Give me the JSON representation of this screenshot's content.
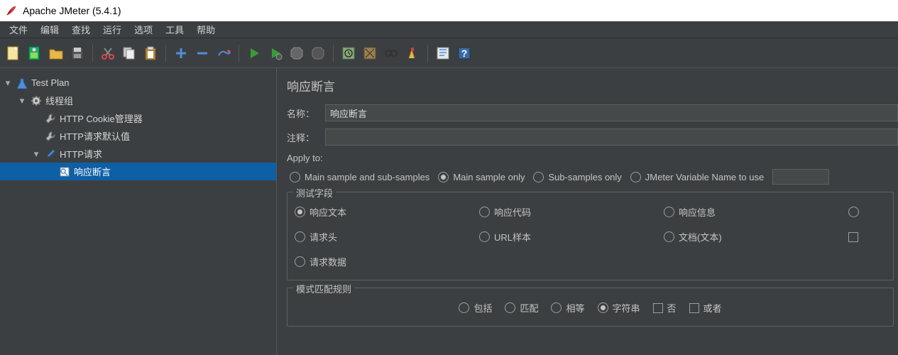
{
  "title": "Apache JMeter (5.4.1)",
  "menu": {
    "file": "文件",
    "edit": "编辑",
    "search": "查找",
    "run": "运行",
    "options": "选项",
    "tools": "工具",
    "help": "帮助"
  },
  "tree": {
    "root": "Test Plan",
    "threadgroup": "线程组",
    "cookie": "HTTP Cookie管理器",
    "defaults": "HTTP请求默认值",
    "request": "HTTP请求",
    "assertion": "响应断言"
  },
  "panel": {
    "heading": "响应断言",
    "name_label": "名称：",
    "name_value": "响应断言",
    "comment_label": "注释：",
    "comment_value": "",
    "apply_to": "Apply to:",
    "apply_opts": {
      "main_sub": "Main sample and sub-samples",
      "main": "Main sample only",
      "sub": "Sub-samples only",
      "var": "JMeter Variable Name to use"
    },
    "test_field_legend": "测试字段",
    "test_fields": {
      "resp_text": "响应文本",
      "resp_code": "响应代码",
      "resp_msg": "响应信息",
      "req_headers": "请求头",
      "url": "URL样本",
      "doc": "文档(文本)",
      "req_data": "请求数据"
    },
    "match_legend": "模式匹配规则",
    "match_opts": {
      "contains": "包括",
      "match": "匹配",
      "equals": "相等",
      "substring": "字符串",
      "not": "否",
      "or": "或者"
    }
  }
}
